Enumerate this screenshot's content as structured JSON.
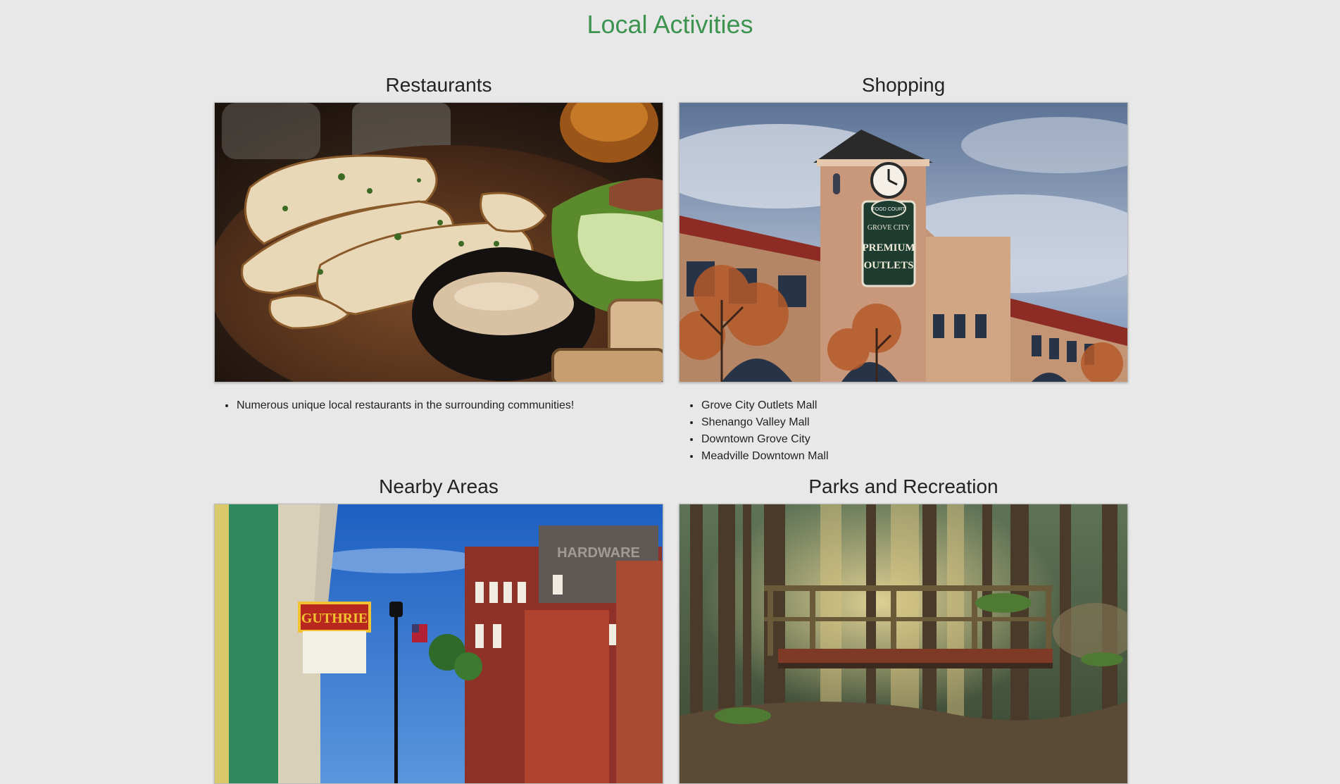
{
  "page": {
    "title": "Local Activities"
  },
  "cards": [
    {
      "heading": "Restaurants",
      "image": "restaurant-food-photo",
      "items": [
        "Numerous unique local restaurants in the surrounding communities!"
      ]
    },
    {
      "heading": "Shopping",
      "image": "outlet-mall-clocktower-photo",
      "sign_top": "FOOD COURT",
      "sign_brand": "GROVE CITY",
      "sign_main_1": "PREMIUM",
      "sign_main_2": "OUTLETS",
      "items": [
        "Grove City Outlets Mall",
        "Shenango Valley Mall",
        "Downtown Grove City",
        "Meadville Downtown Mall"
      ]
    },
    {
      "heading": "Nearby Areas",
      "image": "historic-downtown-street-photo",
      "marquee": "GUTHRIE",
      "wall_sign": "HARDWARE",
      "items": []
    },
    {
      "heading": "Parks and Recreation",
      "image": "forest-bridge-photo",
      "items": []
    }
  ],
  "colors": {
    "background": "#e8e8e8",
    "title": "#3d9350",
    "text": "#222222"
  }
}
